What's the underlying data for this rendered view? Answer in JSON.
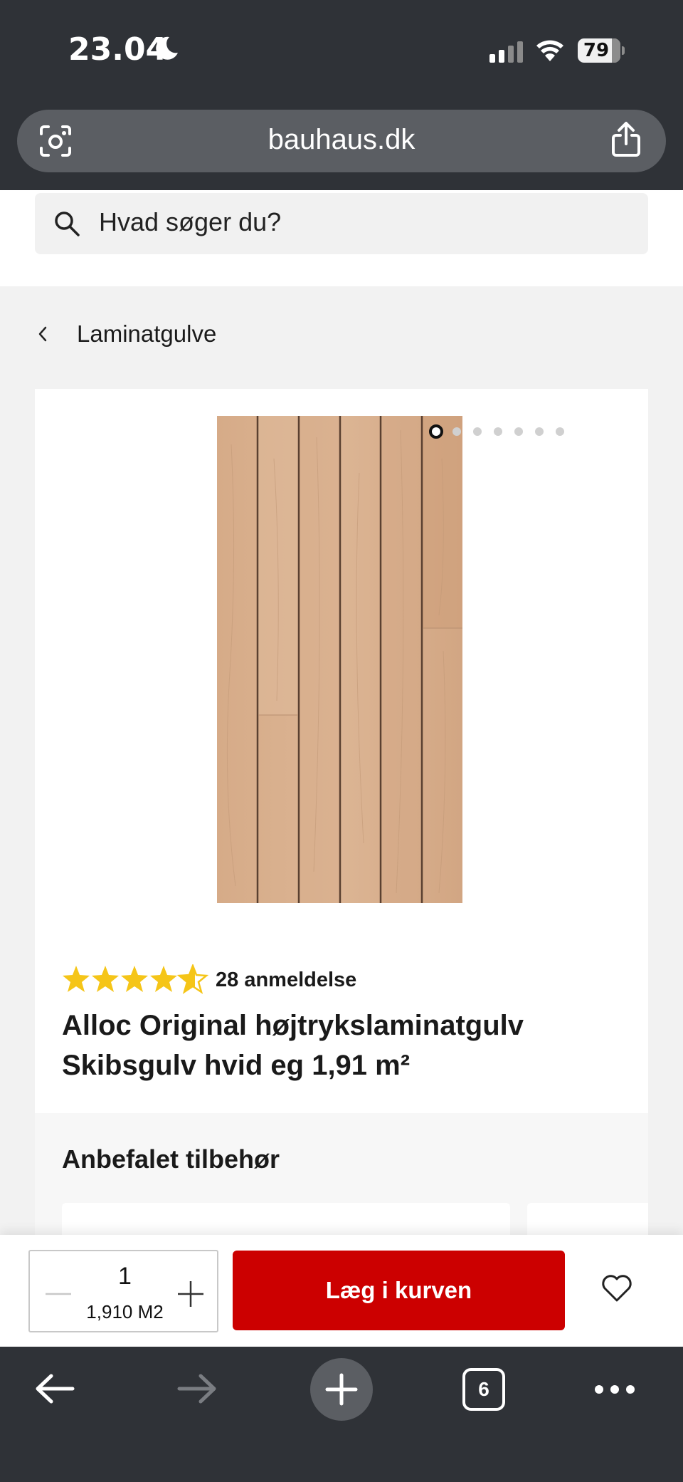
{
  "status_bar": {
    "time": "23.04",
    "battery": "79",
    "icons": [
      "moon-icon",
      "signal-icon",
      "wifi-icon",
      "battery-icon"
    ]
  },
  "browser": {
    "url": "bauhaus.dk",
    "icons": [
      "lens-icon",
      "share-icon"
    ]
  },
  "search": {
    "placeholder": "Hvad søger du?"
  },
  "breadcrumb": {
    "label": "Laminatgulve"
  },
  "product": {
    "image_dots": 7,
    "active_dot": 1,
    "rating": 4.5,
    "rating_max": 5,
    "rating_count_label": "28 anmeldelse",
    "title": "Alloc Original højtrykslaminatgulv Skibsgulv hvid eg 1,91 m²"
  },
  "accessories": {
    "title": "Anbefalet tilbehør"
  },
  "buy_bar": {
    "quantity": "1",
    "unit_amount": "1,910 M2",
    "add_to_cart_label": "Læg i kurven"
  },
  "bottom_toolbar": {
    "tab_count": "6",
    "icons": [
      "back-arrow-icon",
      "forward-arrow-icon",
      "plus-icon",
      "tabs-icon",
      "more-icon"
    ]
  },
  "colors": {
    "chrome": "#2f3237",
    "accent_red": "#cc0000",
    "star_yellow": "#f5c518",
    "page_bg": "#f2f2f2"
  }
}
